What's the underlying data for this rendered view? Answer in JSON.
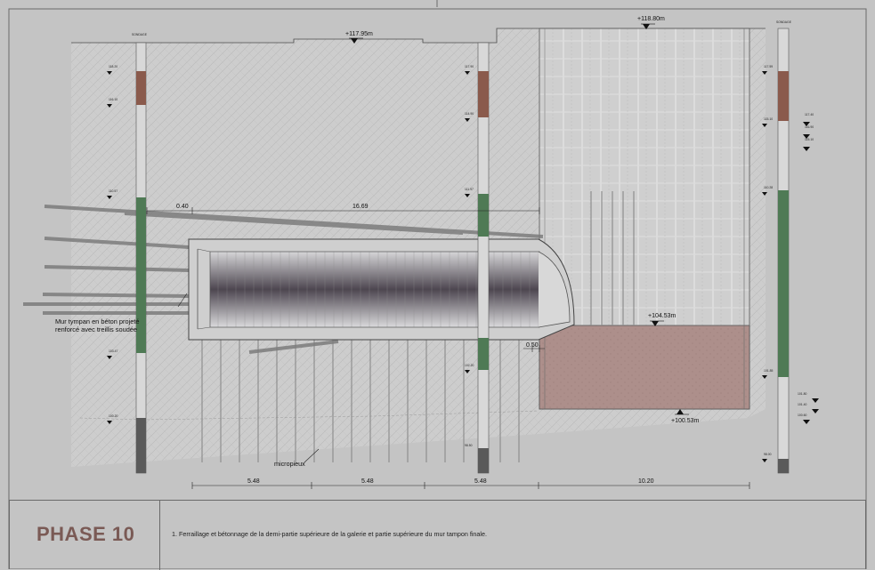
{
  "elevations": {
    "top_left": "+117.95m",
    "top_right": "+118.80m",
    "mid_right": "+104.53m",
    "bottom_right": "+100.53m"
  },
  "dimensions": {
    "upper_left": "0.40",
    "upper_span": "16.69",
    "lower_gap": "0.50",
    "bottom": [
      "5.48",
      "5.48",
      "5.48",
      "10.20"
    ]
  },
  "annotations": {
    "tympan_line1": "Mur tympan en béton projeté",
    "tympan_line2": "renforcé avec treillis soudée",
    "micropieux": "micropieux"
  },
  "footer": {
    "phase": "PHASE 10",
    "note": "1.  Ferraillage et bétonnage de la demi-partie supérieure de la galerie et partie supérieure du mur tampon finale."
  },
  "colors": {
    "sheet": "#c4c4c4",
    "borehole_brown": "#8a5a4c",
    "borehole_green": "#4f7a55",
    "borehole_dark": "#5a5a5a",
    "plug_fill": "#a98a86",
    "title_color": "#7a5a55"
  }
}
